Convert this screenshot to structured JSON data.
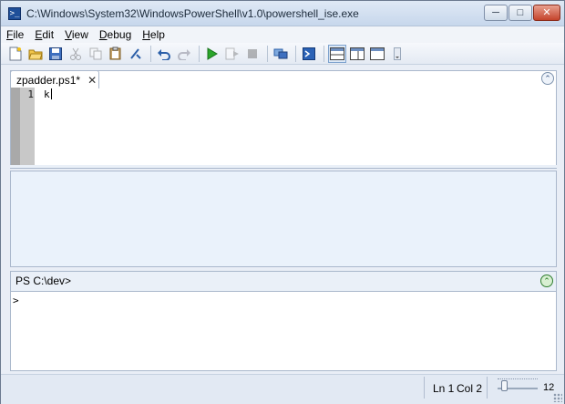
{
  "window": {
    "title": "C:\\Windows\\System32\\WindowsPowerShell\\v1.0\\powershell_ise.exe",
    "controls": {
      "minimize": "─",
      "maximize": "□",
      "close": "✕"
    }
  },
  "menu": [
    {
      "label": "File",
      "mnemonic": "F"
    },
    {
      "label": "Edit",
      "mnemonic": "E"
    },
    {
      "label": "View",
      "mnemonic": "V"
    },
    {
      "label": "Debug",
      "mnemonic": "D"
    },
    {
      "label": "Help",
      "mnemonic": "H"
    }
  ],
  "toolbar": {
    "icons": [
      "new-icon",
      "open-icon",
      "save-icon",
      "cut-icon",
      "copy-icon",
      "paste-icon",
      "clear-icon",
      "undo-icon",
      "redo-icon",
      "run-icon",
      "run-selection-icon",
      "stop-icon",
      "new-remote-tab-icon",
      "start-powershell-icon",
      "layout-top-icon",
      "layout-right-icon",
      "layout-max-icon"
    ]
  },
  "editor": {
    "tab_label": "zpadder.ps1*",
    "tab_close": "✕",
    "line_numbers": [
      "1"
    ],
    "lines": [
      "k"
    ]
  },
  "command_pane": {
    "prompt": "PS C:\\dev>",
    "input_prompt": ">"
  },
  "status": {
    "ln": "Ln 1",
    "col": "Col 2",
    "zoom": "12"
  },
  "colors": {
    "accent": "#1f4f99",
    "run_green": "#2aa52a",
    "output_bg": "#eaf2fb"
  }
}
